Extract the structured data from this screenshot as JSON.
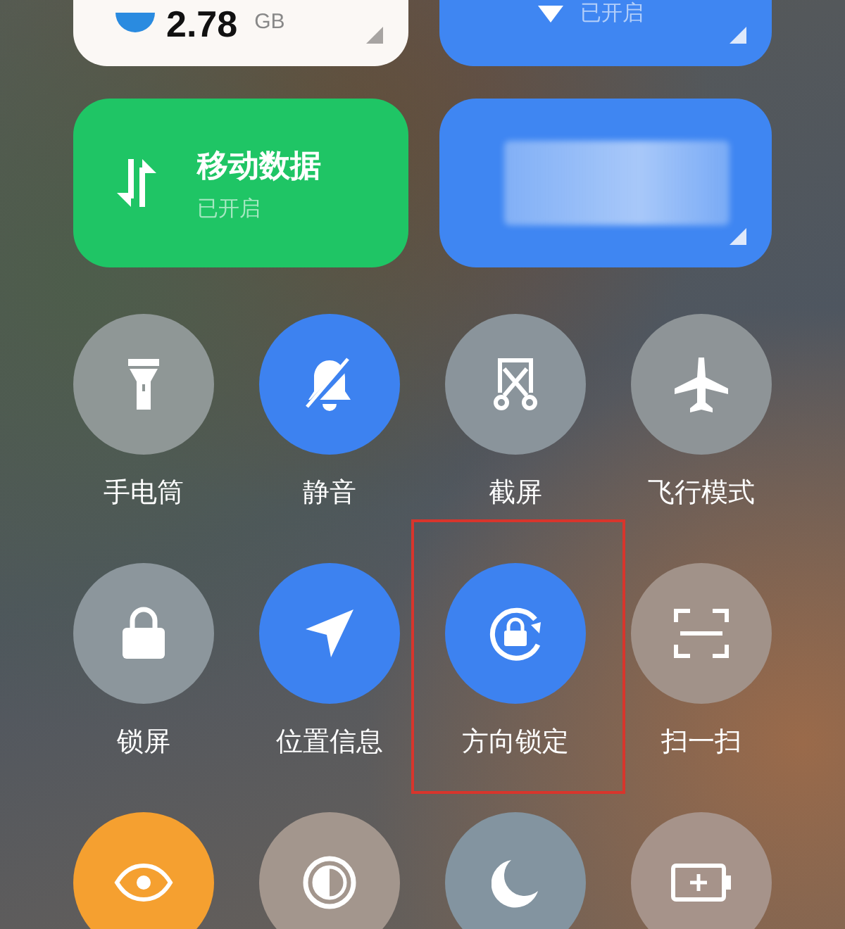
{
  "cards": [
    {
      "kind": "usage",
      "value": "2.78",
      "unit": "GB"
    },
    {
      "kind": "toggle",
      "status": "已开启"
    },
    {
      "kind": "toggle",
      "title": "移动数据",
      "status": "已开启",
      "color": "#1fc565"
    },
    {
      "kind": "blurred",
      "color": "#3f86f2"
    }
  ],
  "tiles": [
    {
      "label": "手电筒",
      "color": "#8f9796"
    },
    {
      "label": "静音",
      "color": "#3d82f0"
    },
    {
      "label": "截屏",
      "color": "#8a949b"
    },
    {
      "label": "飞行模式",
      "color": "#8e9497"
    },
    {
      "label": "锁屏",
      "color": "#8c969c"
    },
    {
      "label": "位置信息",
      "color": "#3d82f0"
    },
    {
      "label": "方向锁定",
      "color": "#3d82f0",
      "highlighted": true
    },
    {
      "label": "扫一扫",
      "color": "#a19289"
    },
    {
      "color": "#f5a030"
    },
    {
      "color": "#a3968d"
    },
    {
      "color": "#8394a0"
    },
    {
      "color": "#a6938a"
    }
  ]
}
